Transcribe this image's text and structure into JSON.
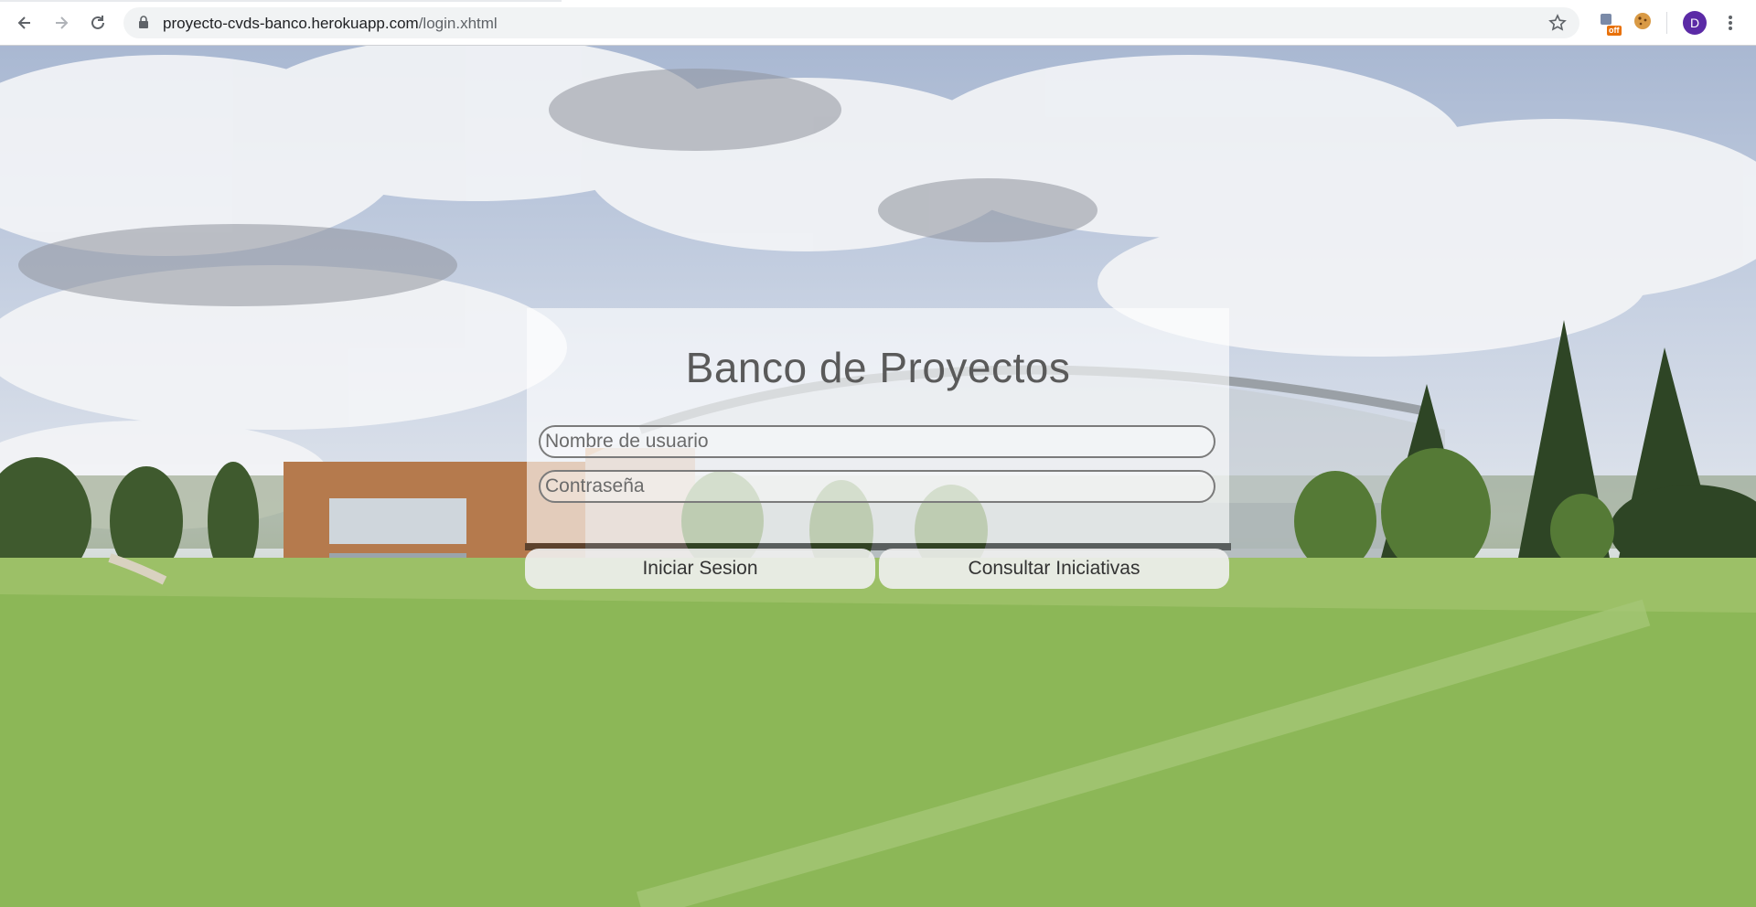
{
  "browser": {
    "url_host": "proyecto-cvds-banco.herokuapp.com",
    "url_path": "/login.xhtml",
    "extension_badge": "off",
    "profile_initial": "D"
  },
  "login": {
    "title": "Banco de Proyectos",
    "username_placeholder": "Nombre de usuario",
    "password_placeholder": "Contraseña",
    "login_button": "Iniciar Sesion",
    "consult_button": "Consultar Iniciativas"
  },
  "colors": {
    "panel_background": "#ffffff",
    "title_text": "#5a5a5a",
    "avatar": "#5b2aa6"
  }
}
